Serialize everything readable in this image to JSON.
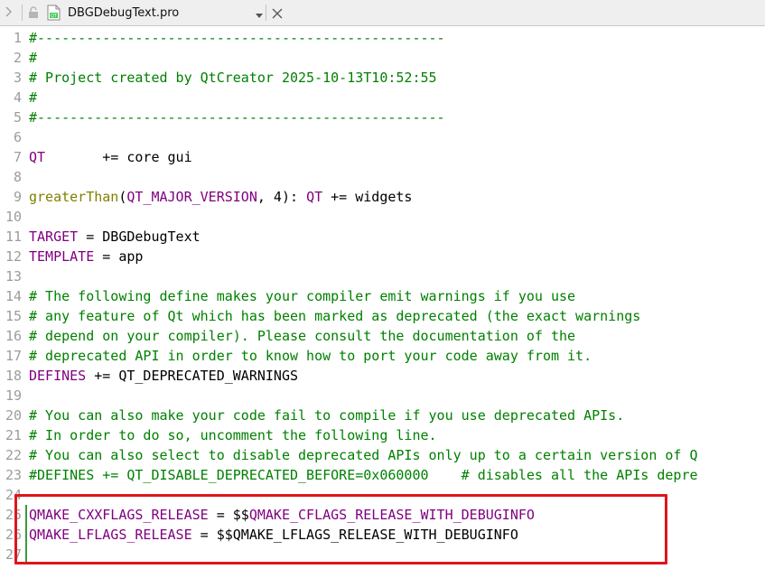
{
  "toolbar": {
    "file_name": "DBGDebugText.pro"
  },
  "editor": {
    "lines": [
      {
        "num": "1",
        "parts": [
          {
            "t": "#--------------------------------------------------",
            "c": "comment"
          }
        ]
      },
      {
        "num": "2",
        "parts": [
          {
            "t": "#",
            "c": "comment"
          }
        ]
      },
      {
        "num": "3",
        "parts": [
          {
            "t": "# Project created by QtCreator 2025-10-13T10:52:55",
            "c": "comment"
          }
        ]
      },
      {
        "num": "4",
        "parts": [
          {
            "t": "#",
            "c": "comment"
          }
        ]
      },
      {
        "num": "5",
        "parts": [
          {
            "t": "#--------------------------------------------------",
            "c": "comment"
          }
        ]
      },
      {
        "num": "6",
        "parts": []
      },
      {
        "num": "7",
        "parts": [
          {
            "t": "QT",
            "c": "var"
          },
          {
            "t": "       += core gui",
            "c": "text"
          }
        ]
      },
      {
        "num": "8",
        "parts": []
      },
      {
        "num": "9",
        "parts": [
          {
            "t": "greaterThan",
            "c": "func"
          },
          {
            "t": "(",
            "c": "text"
          },
          {
            "t": "QT_MAJOR_VERSION",
            "c": "var"
          },
          {
            "t": ", 4): ",
            "c": "text"
          },
          {
            "t": "QT",
            "c": "var"
          },
          {
            "t": " += widgets",
            "c": "text"
          }
        ]
      },
      {
        "num": "10",
        "parts": []
      },
      {
        "num": "11",
        "parts": [
          {
            "t": "TARGET",
            "c": "var"
          },
          {
            "t": " = DBGDebugText",
            "c": "text"
          }
        ]
      },
      {
        "num": "12",
        "parts": [
          {
            "t": "TEMPLATE",
            "c": "var"
          },
          {
            "t": " = app",
            "c": "text"
          }
        ]
      },
      {
        "num": "13",
        "parts": []
      },
      {
        "num": "14",
        "parts": [
          {
            "t": "# The following define makes your compiler emit warnings if you use",
            "c": "comment"
          }
        ]
      },
      {
        "num": "15",
        "parts": [
          {
            "t": "# any feature of Qt which has been marked as deprecated (the exact warnings",
            "c": "comment"
          }
        ]
      },
      {
        "num": "16",
        "parts": [
          {
            "t": "# depend on your compiler). Please consult the documentation of the",
            "c": "comment"
          }
        ]
      },
      {
        "num": "17",
        "parts": [
          {
            "t": "# deprecated API in order to know how to port your code away from it.",
            "c": "comment"
          }
        ]
      },
      {
        "num": "18",
        "parts": [
          {
            "t": "DEFINES",
            "c": "var"
          },
          {
            "t": " += QT_DEPRECATED_WARNINGS",
            "c": "text"
          }
        ]
      },
      {
        "num": "19",
        "parts": []
      },
      {
        "num": "20",
        "parts": [
          {
            "t": "# You can also make your code fail to compile if you use deprecated APIs.",
            "c": "comment"
          }
        ]
      },
      {
        "num": "21",
        "parts": [
          {
            "t": "# In order to do so, uncomment the following line.",
            "c": "comment"
          }
        ]
      },
      {
        "num": "22",
        "parts": [
          {
            "t": "# You can also select to disable deprecated APIs only up to a certain version of Q",
            "c": "comment"
          }
        ]
      },
      {
        "num": "23",
        "parts": [
          {
            "t": "#DEFINES += QT_DISABLE_DEPRECATED_BEFORE=0x060000    # disables all the APIs depre",
            "c": "comment"
          }
        ]
      },
      {
        "num": "24",
        "parts": []
      },
      {
        "num": "25",
        "parts": [
          {
            "t": "QMAKE_CXXFLAGS_RELEASE",
            "c": "var"
          },
          {
            "t": " = $$",
            "c": "text"
          },
          {
            "t": "QMAKE_CFLAGS_RELEASE_WITH_DEBUGINFO",
            "c": "var"
          }
        ],
        "modified": true
      },
      {
        "num": "26",
        "parts": [
          {
            "t": "QMAKE_LFLAGS_RELEASE",
            "c": "var"
          },
          {
            "t": " = $$",
            "c": "text"
          },
          {
            "t": "QMAKE_LFLAGS_RELEASE_WITH_DEBUGINFO",
            "c": "text"
          }
        ],
        "modified": true
      },
      {
        "num": "27",
        "parts": [],
        "modified": true
      }
    ]
  },
  "colors": {
    "comment": "#008000",
    "variable": "#800080",
    "function": "#808000",
    "highlight_box": "#e0151c"
  }
}
